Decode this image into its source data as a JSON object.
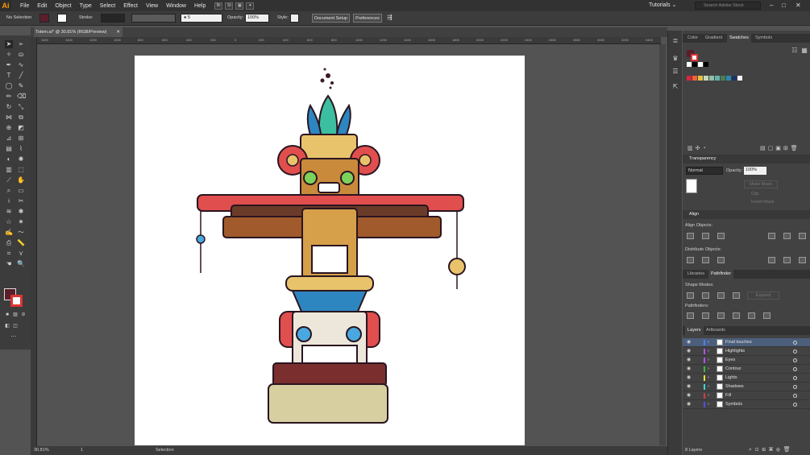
{
  "menubar": {
    "logo": "Ai",
    "items": [
      "File",
      "Edit",
      "Object",
      "Type",
      "Select",
      "Effect",
      "View",
      "Window",
      "Help"
    ],
    "bridge_label": "Br",
    "stock_label": "St",
    "workspace": "Tutorials",
    "search_placeholder": "Search Adobe Stock"
  },
  "controlbar": {
    "selection": "No Selection",
    "stroke_label": "Stroke:",
    "brush_value": "5",
    "opacity_label": "Opacity:",
    "opacity_value": "100%",
    "style_label": "Style:",
    "doc_setup": "Document Setup",
    "preferences": "Preferences"
  },
  "document": {
    "tab_title": "Totem.ai* @ 30.81% (RGB/Preview)",
    "ruler_ticks": [
      "1600",
      "1400",
      "1200",
      "1000",
      "800",
      "600",
      "400",
      "200",
      "0",
      "200",
      "400",
      "600",
      "800",
      "1000",
      "1200",
      "1400",
      "1600",
      "1800",
      "2000",
      "2200",
      "2400",
      "2600",
      "2800",
      "3000",
      "3200",
      "3400",
      "3600"
    ]
  },
  "status": {
    "zoom": "30.81%",
    "artboard_num": "1",
    "tool": "Selection"
  },
  "swatches_panel": {
    "tabs": [
      "Color",
      "Gradient",
      "Swatches",
      "Symbols"
    ],
    "active_tab": "Swatches",
    "colors": [
      "#d7263d",
      "#f46036",
      "#e2c044",
      "#c8d5b9",
      "#8fc0a9",
      "#68b0ab",
      "#4a7c59",
      "#2e86ab",
      "#1d3461",
      "#f5f5f5"
    ]
  },
  "transparency_panel": {
    "title": "Transparency",
    "blend_mode": "Normal",
    "opacity_label": "Opacity:",
    "opacity_value": "100%",
    "make_mask": "Make Mask",
    "clip": "Clip",
    "invert_mask": "Invert Mask"
  },
  "align_panel": {
    "title": "Align",
    "align_objects": "Align Objects:",
    "distribute_objects": "Distribute Objects:"
  },
  "pathfinder_panel": {
    "tabs": [
      "Libraries",
      "Pathfinder"
    ],
    "shape_modes": "Shape Modes:",
    "expand": "Expand",
    "pathfinders": "Pathfinders:"
  },
  "layers_panel": {
    "tabs": [
      "Layers",
      "Artboards"
    ],
    "layers": [
      {
        "name": "Final touches",
        "color": "#4f7fff"
      },
      {
        "name": "Highlights",
        "color": "#b24fff"
      },
      {
        "name": "Eyes",
        "color": "#b24fff"
      },
      {
        "name": "Contour",
        "color": "#3bbb3b"
      },
      {
        "name": "Lights",
        "color": "#e8e03b"
      },
      {
        "name": "Shadows",
        "color": "#3bd8d8"
      },
      {
        "name": "Fill",
        "color": "#d83b3b"
      },
      {
        "name": "Symbols",
        "color": "#4f4fff"
      }
    ],
    "count": "8 Layers"
  }
}
